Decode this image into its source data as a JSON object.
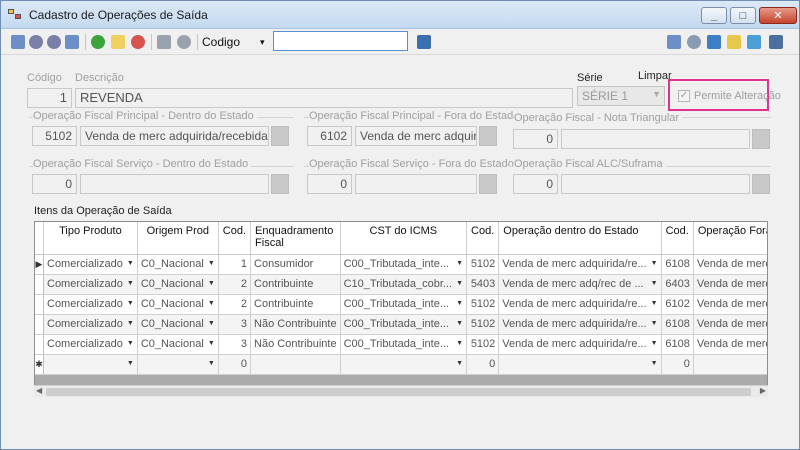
{
  "window": {
    "title": "Cadastro de Operações de Saída",
    "min": "_",
    "max": "□",
    "close": "✕"
  },
  "toolbar": {
    "search_mode_label": "Codigo",
    "search_mode_arrow": "▾",
    "search_value": "",
    "icons": [
      "first-record-icon",
      "previous-record-icon",
      "next-record-icon",
      "last-record-icon",
      "add-icon",
      "edit-icon",
      "cancel-icon",
      "save-icon",
      "undo-icon",
      "go-icon",
      "report-icon",
      "settings-icon",
      "print-icon",
      "note-icon",
      "transfer-icon",
      "exit-icon"
    ]
  },
  "form": {
    "codigo_label": "Código",
    "codigo_value": "1",
    "descricao_label": "Descrição",
    "descricao_value": "REVENDA",
    "serie_label": "Série",
    "limpar_label": "Limpar",
    "serie_value": "SÉRIE 1",
    "permite_alteracao_label": "Permite Alteração",
    "permite_alteracao_checked": true,
    "op_principal_dentro": {
      "label": "Operação Fiscal Principal - Dentro do Estado",
      "code": "5102",
      "desc": "Venda de merc adquirida/recebida"
    },
    "op_principal_fora": {
      "label": "Operação Fiscal Principal - Fora do Estado",
      "code": "6102",
      "desc": "Venda de merc adquirida/recebida"
    },
    "op_nota_triangular": {
      "label": "Operação Fiscal - Nota Triangular",
      "code": "0",
      "desc": ""
    },
    "op_servico_dentro": {
      "label": "Operação Fiscal Serviço - Dentro do Estado",
      "code": "0",
      "desc": ""
    },
    "op_servico_fora": {
      "label": "Operação Fiscal Serviço - Fora do Estado",
      "code": "0",
      "desc": ""
    },
    "op_alc_suframa": {
      "label": "Operação Fiscal ALC/Suframa",
      "code": "0",
      "desc": ""
    }
  },
  "grid": {
    "label": "Itens da Operação de Saída",
    "columns": [
      "Tipo Produto",
      "Origem Prod",
      "Cod.",
      "Enquadramento Fiscal",
      "CST do ICMS",
      "Cod.",
      "Operação dentro do Estado",
      "Cod.",
      "Operação Fora do Estado"
    ],
    "rows": [
      [
        "Comercializado",
        "C0_Nacional",
        "1",
        "Consumidor",
        "C00_Tributada_inte...",
        "5102",
        "Venda de merc adquirida/re...",
        "6108",
        "Venda de merc adquirida/re..."
      ],
      [
        "Comercializado",
        "C0_Nacional",
        "2",
        "Contribuinte",
        "C10_Tributada_cobr...",
        "5403",
        "Venda de merc adq/rec de ...",
        "6403",
        "Venda de merc adq/rec de ..."
      ],
      [
        "Comercializado",
        "C0_Nacional",
        "2",
        "Contribuinte",
        "C00_Tributada_inte...",
        "5102",
        "Venda de merc adquirida/re...",
        "6102",
        "Venda de merc adquirida/re..."
      ],
      [
        "Comercializado",
        "C0_Nacional",
        "3",
        "Não Contribuinte",
        "C00_Tributada_inte...",
        "5102",
        "Venda de merc adquirida/re...",
        "6108",
        "Venda de merc adquirida/re..."
      ],
      [
        "Comercializado",
        "C0_Nacional",
        "3",
        "Não Contribuinte",
        "C00_Tributada_inte...",
        "5102",
        "Venda de merc adquirida/re...",
        "6108",
        "Venda de merc adquirida/re..."
      ]
    ],
    "new_row": [
      "",
      "",
      "0",
      "",
      "",
      "0",
      "",
      "0",
      ""
    ],
    "current_marker": "▶",
    "new_marker": "✱"
  }
}
